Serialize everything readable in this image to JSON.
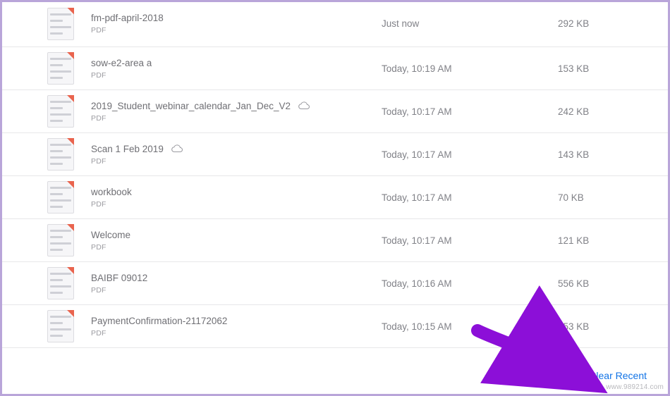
{
  "files": [
    {
      "name": "fm-pdf-april-2018",
      "type": "PDF",
      "date": "Just now",
      "size": "292 KB",
      "cloud": false
    },
    {
      "name": "sow-e2-area a",
      "type": "PDF",
      "date": "Today, 10:19 AM",
      "size": "153 KB",
      "cloud": false
    },
    {
      "name": "2019_Student_webinar_calendar_Jan_Dec_V2",
      "type": "PDF",
      "date": "Today, 10:17 AM",
      "size": "242 KB",
      "cloud": true
    },
    {
      "name": "Scan 1 Feb 2019",
      "type": "PDF",
      "date": "Today, 10:17 AM",
      "size": "143 KB",
      "cloud": true
    },
    {
      "name": "workbook",
      "type": "PDF",
      "date": "Today, 10:17 AM",
      "size": "70 KB",
      "cloud": false
    },
    {
      "name": "Welcome",
      "type": "PDF",
      "date": "Today, 10:17 AM",
      "size": "121 KB",
      "cloud": false
    },
    {
      "name": "BAIBF 09012",
      "type": "PDF",
      "date": "Today, 10:16 AM",
      "size": "556 KB",
      "cloud": false
    },
    {
      "name": "PaymentConfirmation-21172062",
      "type": "PDF",
      "date": "Today, 10:15 AM",
      "size": "253 KB",
      "cloud": false
    }
  ],
  "footer": {
    "clear_label": "Clear Recent"
  },
  "watermark": "www.989214.com",
  "colors": {
    "arrow": "#8c0fd8",
    "link": "#1173e6",
    "border": "#b9a5d9"
  }
}
